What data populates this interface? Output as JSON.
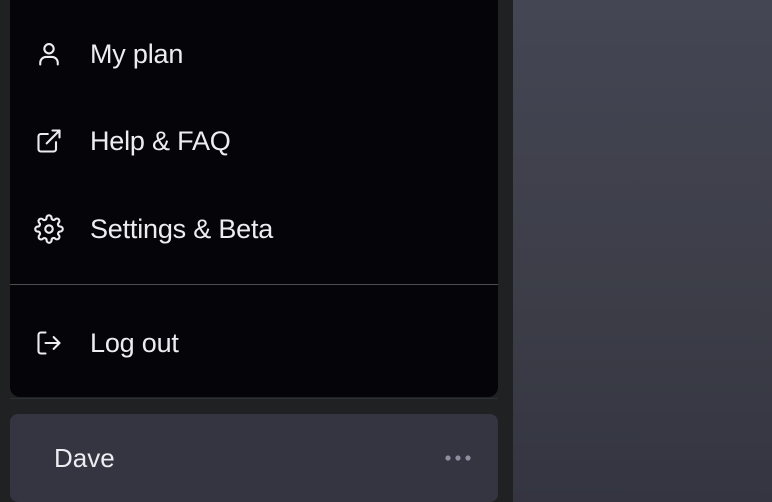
{
  "menu": {
    "items": [
      {
        "label": "My plan",
        "icon": "user-icon"
      },
      {
        "label": "Help & FAQ",
        "icon": "external-link-icon"
      },
      {
        "label": "Settings & Beta",
        "icon": "gear-icon"
      },
      {
        "label": "Log out",
        "icon": "logout-icon"
      }
    ]
  },
  "user": {
    "name": "Dave",
    "more_icon": "more-horizontal-icon"
  },
  "colors": {
    "menu_bg": "#050509",
    "sidebar_bg": "#202123",
    "user_card_bg": "#343541",
    "text": "#ececf1",
    "muted": "#8e8ea0"
  }
}
